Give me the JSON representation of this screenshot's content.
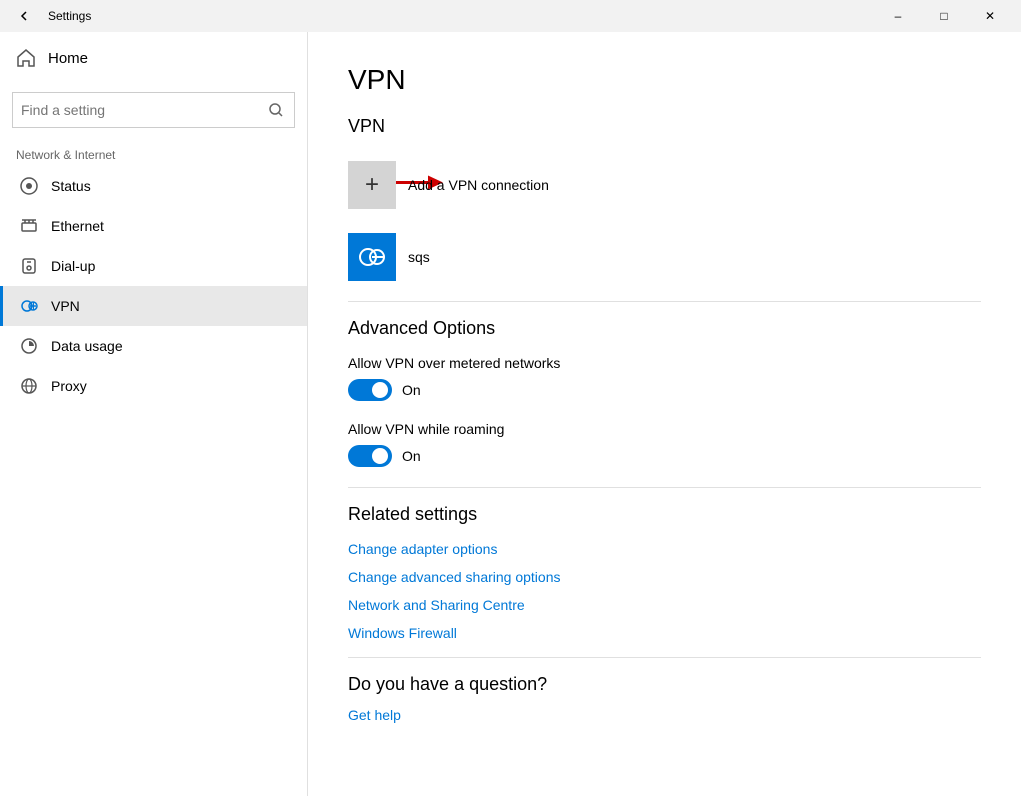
{
  "titlebar": {
    "title": "Settings",
    "minimize_label": "–",
    "maximize_label": "□",
    "close_label": "✕"
  },
  "sidebar": {
    "home_label": "Home",
    "search_placeholder": "Find a setting",
    "category_label": "Network & Internet",
    "nav_items": [
      {
        "id": "status",
        "label": "Status",
        "icon": "globe"
      },
      {
        "id": "ethernet",
        "label": "Ethernet",
        "icon": "ethernet"
      },
      {
        "id": "dialup",
        "label": "Dial-up",
        "icon": "phone"
      },
      {
        "id": "vpn",
        "label": "VPN",
        "icon": "vpn",
        "active": true
      },
      {
        "id": "datausage",
        "label": "Data usage",
        "icon": "chart"
      },
      {
        "id": "proxy",
        "label": "Proxy",
        "icon": "proxy"
      }
    ]
  },
  "content": {
    "page_title": "VPN",
    "section_vpn_title": "VPN",
    "add_vpn_label": "Add a VPN connection",
    "vpn_item_label": "sqs",
    "advanced_options_title": "Advanced Options",
    "toggle1": {
      "label": "Allow VPN over metered networks",
      "value": "On",
      "enabled": true
    },
    "toggle2": {
      "label": "Allow VPN while roaming",
      "value": "On",
      "enabled": true
    },
    "related_settings_title": "Related settings",
    "related_links": [
      "Change adapter options",
      "Change advanced sharing options",
      "Network and Sharing Centre",
      "Windows Firewall"
    ],
    "question_title": "Do you have a question?",
    "get_help_label": "Get help"
  },
  "colors": {
    "accent": "#0078d7",
    "sidebar_active_border": "#0078d7",
    "toggle_on": "#0078d7",
    "link": "#0078d7"
  }
}
